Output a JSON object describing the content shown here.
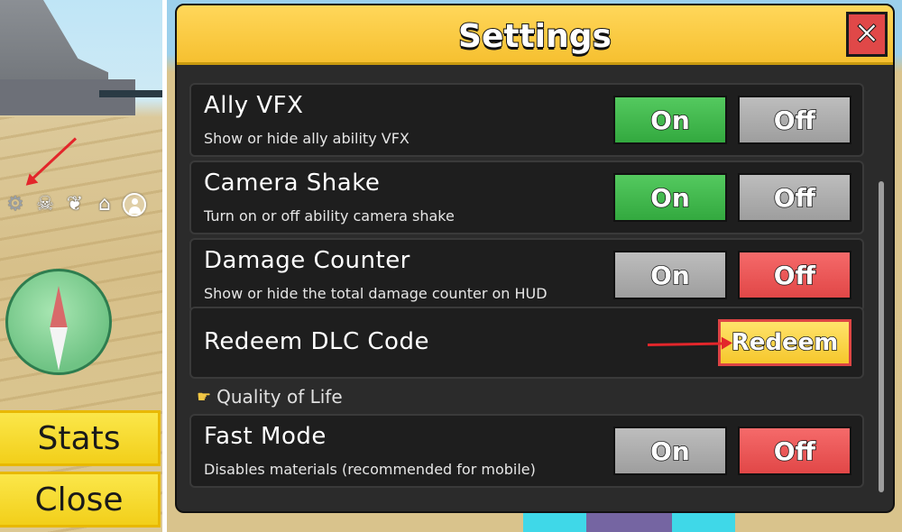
{
  "left_panel": {
    "hud_icons": [
      "gear-icon",
      "skull-crossbones-icon",
      "angel-wings-icon",
      "home-icon",
      "profile-icon"
    ],
    "stats_label": "Stats",
    "close_label": "Close"
  },
  "settings": {
    "title": "Settings",
    "close_symbol": "✕",
    "rows": [
      {
        "label": "Ally VFX",
        "desc": "Show or hide ally ability VFX",
        "on_label": "On",
        "off_label": "Off",
        "state": "on"
      },
      {
        "label": "Camera Shake",
        "desc": "Turn on or off ability camera shake",
        "on_label": "On",
        "off_label": "Off",
        "state": "on"
      },
      {
        "label": "Damage Counter",
        "desc": "Show or hide the total damage counter on HUD",
        "on_label": "On",
        "off_label": "Off",
        "state": "off"
      },
      {
        "label": "Redeem DLC Code",
        "button_label": "Redeem"
      },
      {
        "label": "Fast Mode",
        "desc": "Disables materials (recommended for mobile)",
        "on_label": "On",
        "off_label": "Off",
        "state": "off"
      }
    ],
    "section_qol": "Quality of Life"
  },
  "colors": {
    "on_active": "#3cb64a",
    "off_active": "#e84e4e",
    "inactive": "#a8a8a8",
    "header": "#f8c93c",
    "annotation_arrow": "#e3262b"
  }
}
